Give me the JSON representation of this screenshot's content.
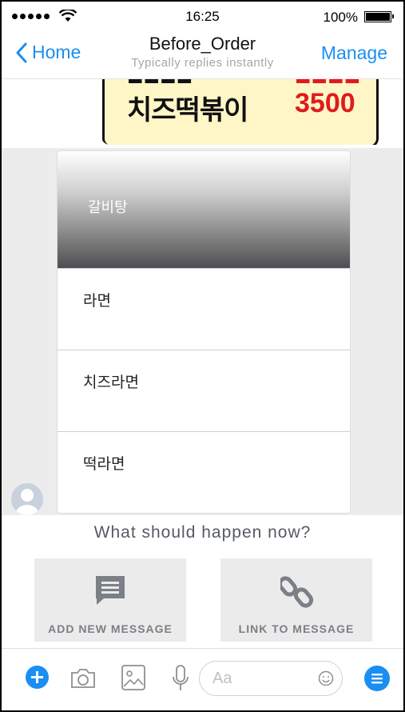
{
  "status_bar": {
    "time": "16:25",
    "battery": "100%"
  },
  "nav": {
    "back_label": "Home",
    "title": "Before_Order",
    "subtitle": "Typically replies instantly",
    "manage_label": "Manage"
  },
  "image_message": {
    "rows": [
      {
        "name": "치즈떡볶이",
        "price": "3500"
      }
    ]
  },
  "card": {
    "header": "갈비탕",
    "items": [
      "라면",
      "치즈라면",
      "떡라면"
    ]
  },
  "prompt": "What should happen now?",
  "actions": [
    {
      "label": "ADD NEW MESSAGE",
      "icon": "message-icon"
    },
    {
      "label": "LINK TO MESSAGE",
      "icon": "link-icon"
    }
  ],
  "composer": {
    "placeholder": "Aa"
  },
  "colors": {
    "accent": "#1a8ef2",
    "price_red": "#e01b1b"
  }
}
